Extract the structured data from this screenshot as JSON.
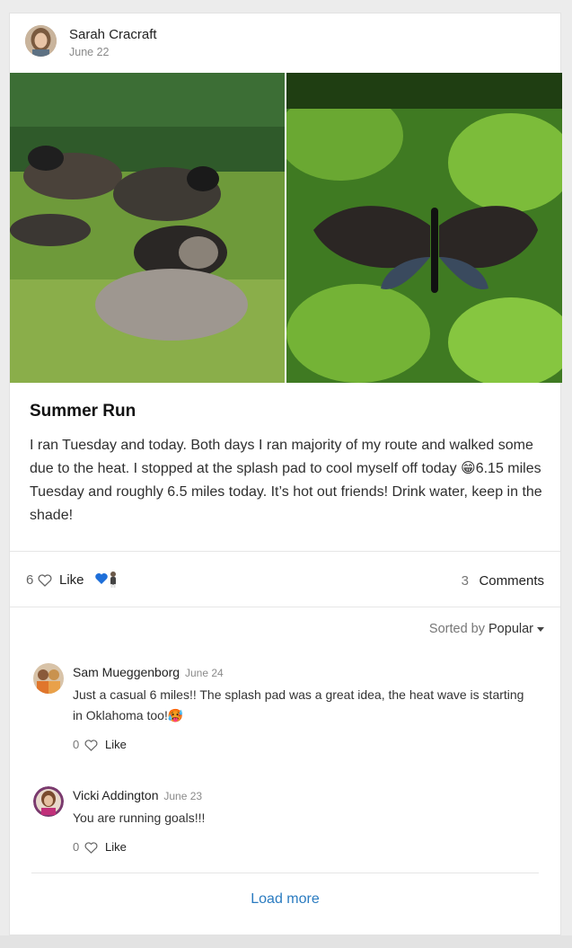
{
  "post": {
    "author": "Sarah Cracraft",
    "date": "June 22",
    "title": "Summer Run",
    "body": "I ran Tuesday and today. Both days I ran majority of my route and walked some due to the heat. I stopped at the splash pad to cool myself off today 😁6.15 miles Tuesday and roughly 6.5 miles today. It’s hot out friends! Drink water, keep in the shade!",
    "like_count": "6",
    "like_label": "Like",
    "comments_count": "3",
    "comments_label": "Comments"
  },
  "sort": {
    "label": "Sorted by",
    "value": "Popular"
  },
  "comments": [
    {
      "author": "Sam Mueggenborg",
      "date": "June 24",
      "text": "Just a casual 6 miles!! The splash pad was a great idea, the heat wave is starting in Oklahoma too!🥵",
      "like_count": "0",
      "like_label": "Like"
    },
    {
      "author": "Vicki Addington",
      "date": "June 23",
      "text": "You are running goals!!!",
      "like_count": "0",
      "like_label": "Like"
    }
  ],
  "load_more": "Load more",
  "colors": {
    "link": "#2a7bc0",
    "heart_reaction": "#1e6fd9"
  }
}
